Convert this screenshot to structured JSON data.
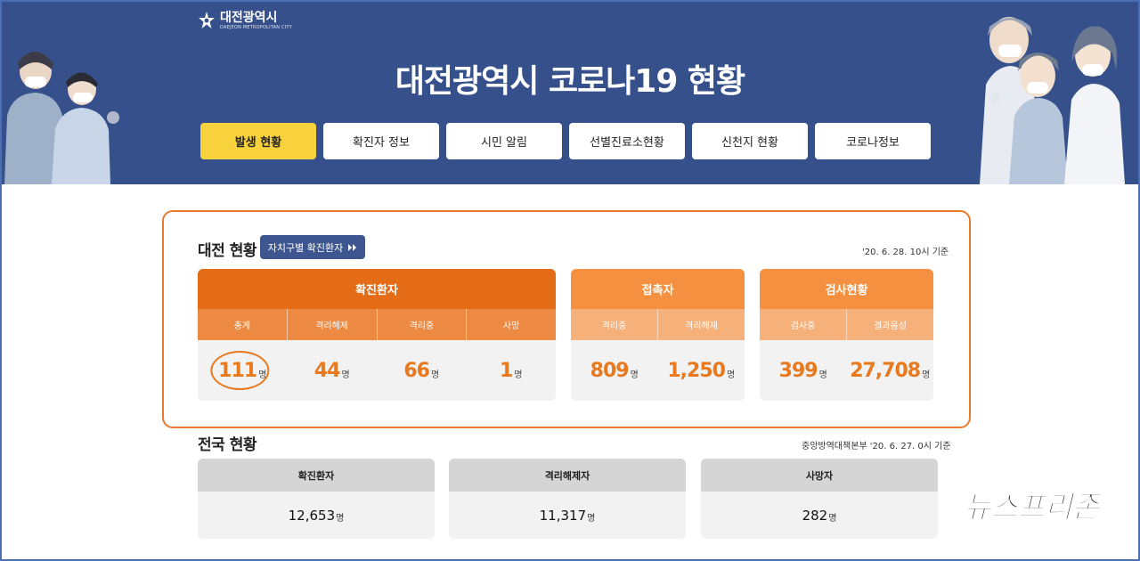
{
  "header": {
    "logo_ko": "대전광역시",
    "logo_en": "DAEJEON METROPOLITAN CITY",
    "title": "대전광역시 코로나19 현황",
    "nav": [
      "발생 현황",
      "확진자 정보",
      "시민 알림",
      "선별진료소현황",
      "신천지 현황",
      "코로나정보"
    ],
    "active_nav": "발생 현황"
  },
  "daejeon": {
    "title": "대전 현황",
    "district_button": "자치구별 확진환자",
    "stamp": "'20. 6. 28. 10시 기준",
    "confirmed": {
      "title": "확진환자",
      "columns": [
        "총계",
        "격리해제",
        "격리중",
        "사망"
      ],
      "values": [
        "111",
        "44",
        "66",
        "1"
      ]
    },
    "contacts": {
      "title": "접촉자",
      "columns": [
        "격리중",
        "격리해제"
      ],
      "values": [
        "809",
        "1,250"
      ]
    },
    "tests": {
      "title": "검사현황",
      "columns": [
        "검사중",
        "결과음성"
      ],
      "values": [
        "399",
        "27,708"
      ]
    },
    "unit": "명"
  },
  "national": {
    "title": "전국 현황",
    "stamp": "중앙방역대책본부 '20. 6. 27. 0시 기준",
    "cards": [
      {
        "label": "확진환자",
        "value": "12,653"
      },
      {
        "label": "격리해제자",
        "value": "11,317"
      },
      {
        "label": "사망자",
        "value": "282"
      }
    ],
    "unit": "명"
  },
  "watermark": "뉴스프리존",
  "colors": {
    "header_bg": "#35508a",
    "active_nav": "#f7d23d",
    "accent_orange": "#e46c16",
    "light_orange": "#f4903f",
    "number_orange": "#e8791e"
  }
}
